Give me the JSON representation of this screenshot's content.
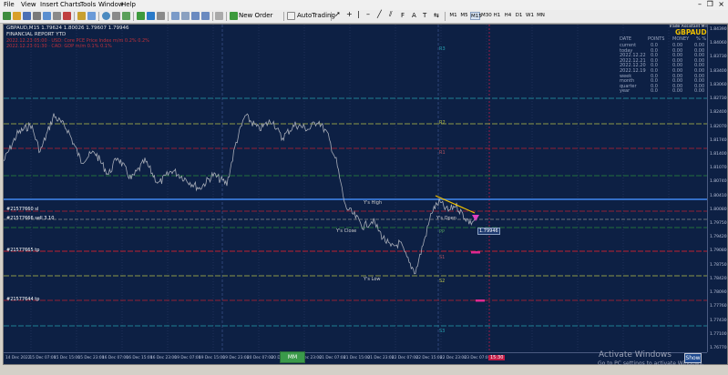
{
  "menu": [
    "File",
    "View",
    "Insert",
    "Charts",
    "Tools",
    "Window",
    "Help"
  ],
  "toolbar": {
    "new_order": "New Order",
    "auto_trading": "AutoTrading",
    "timeframes": [
      "M1",
      "M5",
      "M15",
      "M30",
      "H1",
      "H4",
      "D1",
      "W1",
      "MN"
    ]
  },
  "chart": {
    "title_line": "GBPAUD,M15  1.79624  1.80026  1.79607  1.79946",
    "subtitle": "FINANCIAL REPORT YTD",
    "red_lines": [
      "2022.12.23 05:00 · USD: Core PCE Price Index m/m     0.2%    0.2%",
      "2022.12.23 01:30 · CAD: GDP m/m                      0.1%    0.1%"
    ],
    "trade_assistant": "Trade Assistant MT4 b2",
    "symbol_badge": "GBPAUD",
    "stats_headers": [
      "DATE",
      "POINTS",
      "MONEY",
      "% %"
    ],
    "stats_rows": [
      [
        "current",
        "0.0",
        "0.00",
        "0.00"
      ],
      [
        "today",
        "0.0",
        "0.00",
        "0.00"
      ],
      [
        "2022.12.22",
        "0.0",
        "0.00",
        "0.00"
      ],
      [
        "2022.12.21",
        "0.0",
        "0.00",
        "0.00"
      ],
      [
        "2022.12.20",
        "0.0",
        "0.00",
        "0.00"
      ],
      [
        "2022.12.19",
        "0.0",
        "0.00",
        "0.00"
      ],
      [
        "week",
        "0.0",
        "0.00",
        "0.00"
      ],
      [
        "month",
        "0.0",
        "0.00",
        "0.00"
      ],
      [
        "quarter",
        "0.0",
        "0.00",
        "0.00"
      ],
      [
        "year",
        "0.0",
        "0.00",
        "0.00"
      ]
    ],
    "level_labels": [
      "R3",
      "R2",
      "R1",
      "PP",
      "S1",
      "S2",
      "S3"
    ],
    "annotations": {
      "ys_high": "Y's High",
      "ys_open": "Y's Open",
      "ys_close": "Y's Close",
      "ys_low": "Y's Low",
      "price_tag": "1.79946"
    },
    "order_labels": [
      "#21577660 sl",
      "#21577666 sell 3.10",
      "#21577665 tp",
      "#21577644 tp"
    ],
    "price_ticks": [
      "1.84390",
      "1.84060",
      "1.83730",
      "1.83400",
      "1.83060",
      "1.82730",
      "1.82400",
      "1.82070",
      "1.81740",
      "1.81400",
      "1.81070",
      "1.80740",
      "1.80410",
      "1.80080",
      "1.79750",
      "1.79420",
      "1.79080",
      "1.78750",
      "1.78420",
      "1.78090",
      "1.77760",
      "1.77430",
      "1.77100",
      "1.76770"
    ],
    "time_ticks": [
      "14 Dec 2022",
      "15 Dec 07:00",
      "15 Dec 15:00",
      "15 Dec 23:00",
      "16 Dec 07:00",
      "16 Dec 15:00",
      "16 Dec 23:00",
      "19 Dec 07:00",
      "19 Dec 15:00",
      "19 Dec 23:00",
      "20 Dec 07:00",
      "20 Dec 15:00",
      "20 Dec 23:00",
      "21 Dec 07:00",
      "21 Dec 15:00",
      "21 Dec 23:00",
      "22 Dec 07:00",
      "22 Dec 15:00",
      "22 Dec 23:00",
      "23 Dec 07:00"
    ],
    "mm_button": "MM",
    "time_tag": "15:30"
  },
  "activate": {
    "title": "Activate Windows",
    "sub": "Go to PC settings to activate Windows."
  },
  "show_button": "Show"
}
